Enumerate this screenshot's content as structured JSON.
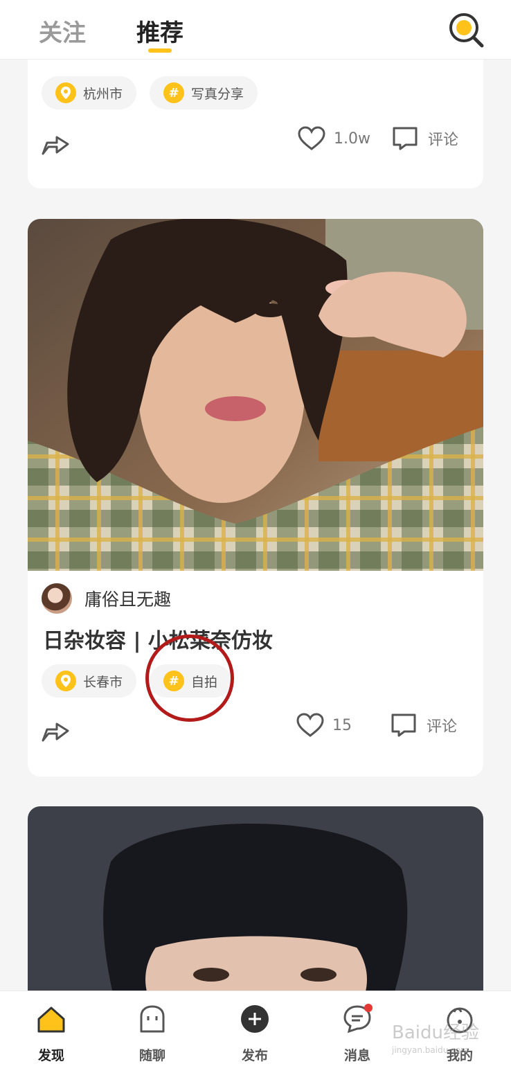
{
  "header": {
    "tabs": [
      {
        "label": "关注",
        "active": false
      },
      {
        "label": "推荐",
        "active": true
      }
    ],
    "accent_color": "#ffc21a",
    "search_icon": "search-icon"
  },
  "feed": {
    "cards": [
      {
        "location": "杭州市",
        "topic": "写真分享",
        "likes": "1.0w",
        "comment_label": "评论"
      },
      {
        "author": "庸俗且无趣",
        "title": "日杂妆容 | 小松菜奈仿妆",
        "location": "长春市",
        "topic": "自拍",
        "likes": "15",
        "comment_label": "评论"
      }
    ]
  },
  "bottom_nav": {
    "items": [
      {
        "label": "发现",
        "icon": "home-icon",
        "active": true
      },
      {
        "label": "随聊",
        "icon": "chat-ghost-icon",
        "active": false
      },
      {
        "label": "发布",
        "icon": "plus-icon",
        "active": false
      },
      {
        "label": "消息",
        "icon": "message-icon",
        "active": false,
        "badge": true
      },
      {
        "label": "我的",
        "icon": "profile-icon",
        "active": false
      }
    ]
  },
  "watermark": {
    "text": "Baidu经验",
    "url_text": "jingyan.baidu.com"
  }
}
